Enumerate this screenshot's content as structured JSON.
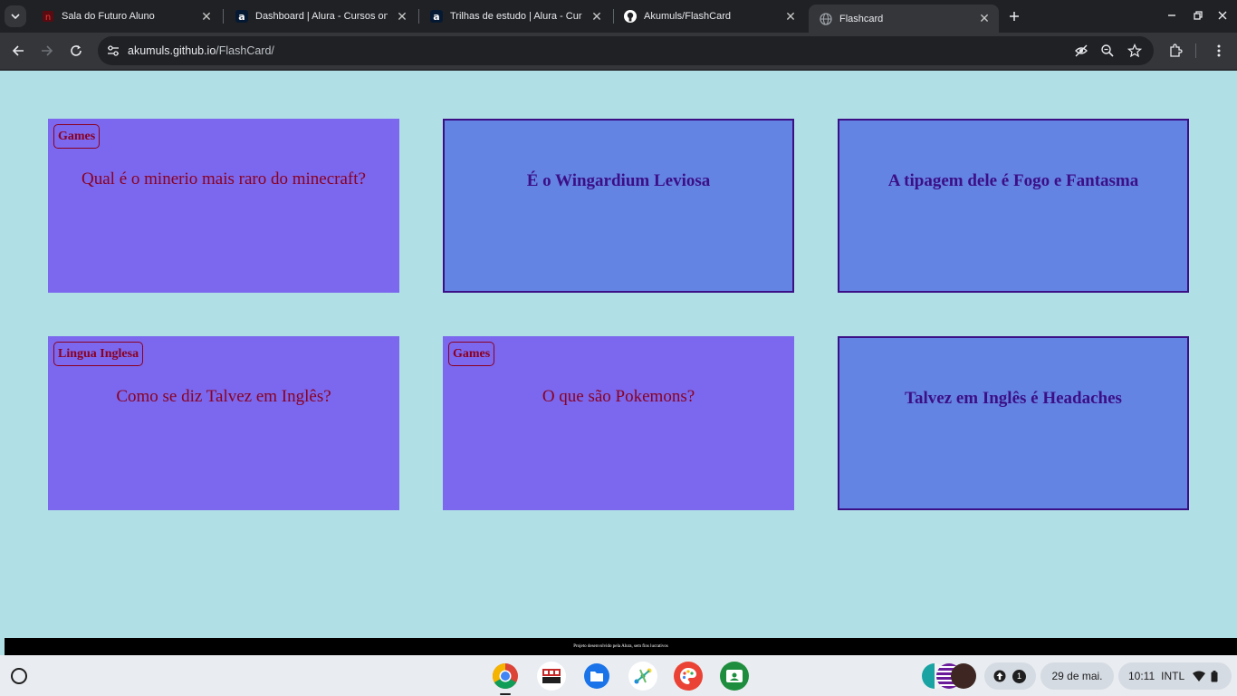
{
  "browser": {
    "tabs": [
      {
        "title": "Sala do Futuro Aluno",
        "active": false
      },
      {
        "title": "Dashboard | Alura - Cursos online",
        "active": false
      },
      {
        "title": "Trilhas de estudo | Alura - Cursos",
        "active": false
      },
      {
        "title": "Akumuls/FlashCard",
        "active": false
      },
      {
        "title": "Flashcard",
        "active": true
      }
    ],
    "url_host": "akumuls.github.io",
    "url_path": "/FlashCard/"
  },
  "cards": [
    {
      "kind": "question",
      "category": "Games",
      "text": "Qual é o minerio mais raro do minecraft?"
    },
    {
      "kind": "answer",
      "text": "É o Wingardium Leviosa"
    },
    {
      "kind": "answer",
      "text": "A tipagem dele é Fogo e Fantasma"
    },
    {
      "kind": "question",
      "category": "Lingua Inglesa",
      "text": "Como se diz Talvez em Inglês?"
    },
    {
      "kind": "question",
      "category": "Games",
      "text": "O que são Pokemons?"
    },
    {
      "kind": "answer",
      "text": "Talvez em Inglês é Headaches"
    }
  ],
  "footer": {
    "text": "Projeto desenvolvido pela Alura, sem fins lucrativos"
  },
  "shelf": {
    "apps": [
      "chrome-icon",
      "sala-do-futuro-icon",
      "files-icon",
      "app-4-icon",
      "paint-icon",
      "classroom-icon"
    ],
    "notification_count": "1",
    "date": "29 de mai.",
    "time": "10:11",
    "ime": "INTL"
  },
  "colors": {
    "page_bg": "#b0dfe5",
    "question_card": "#7b68ee",
    "answer_card": "#6484e4",
    "question_text": "#8b0020",
    "answer_text": "#3b0f86"
  }
}
